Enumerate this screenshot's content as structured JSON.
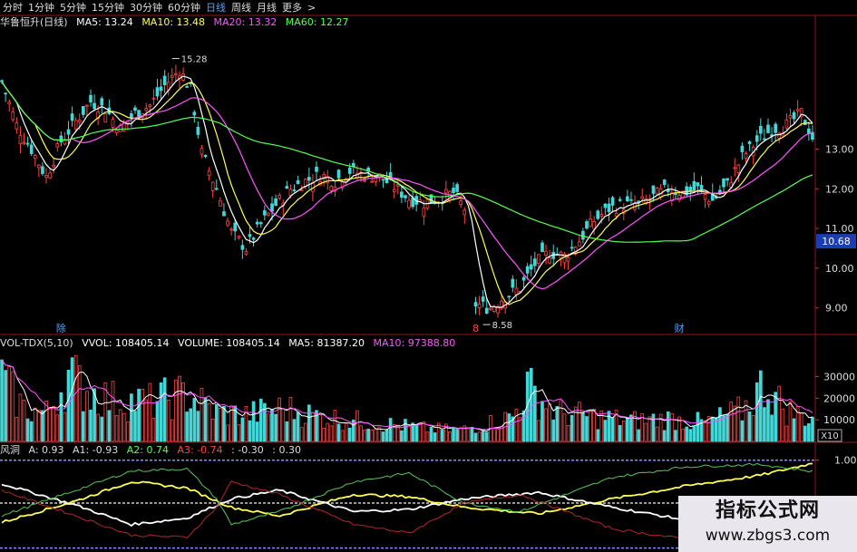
{
  "tabs": [
    {
      "label": "分时",
      "active": false
    },
    {
      "label": "1分钟",
      "active": false
    },
    {
      "label": "5分钟",
      "active": false
    },
    {
      "label": "15分钟",
      "active": false
    },
    {
      "label": "30分钟",
      "active": false
    },
    {
      "label": "60分钟",
      "active": false
    },
    {
      "label": "日线",
      "active": true
    },
    {
      "label": "周线",
      "active": false
    },
    {
      "label": "月线",
      "active": false
    },
    {
      "label": "更多",
      "active": false
    },
    {
      "label": ">",
      "active": false
    }
  ],
  "price_info": {
    "stock": "华鲁恒升(日线)",
    "ma5": "MA5: 13.24",
    "ma10": "MA10: 13.48",
    "ma20": "MA20: 13.32",
    "ma60": "MA60: 12.27"
  },
  "vol_info": {
    "name": "VOL-TDX(5,10)",
    "vvol": "VVOL: 108405.14",
    "volume": "VOLUME: 108405.14",
    "ma5": "MA5: 81387.20",
    "ma10": "MA10: 97388.80"
  },
  "ind_info": {
    "name": "风洞",
    "a": "A: 0.93",
    "a1": "A1: -0.93",
    "a2": "A2: 0.74",
    "a3": "A3: -0.74",
    "v1": ": -0.30",
    "v2": ": 0.30"
  },
  "colors": {
    "up": "#ff4545",
    "down": "#45d6d6",
    "ma5": "#ffffff",
    "ma10": "#ffff55",
    "ma20": "#ff55ff",
    "ma60": "#55ff55",
    "axis": "#8a1a1a",
    "grid": "#5a1010"
  },
  "watermark": {
    "title": "指标公式网",
    "url": "www.zbgs3.com"
  },
  "chart_data": [
    {
      "type": "candlestick",
      "y_ticks": [
        9.0,
        10.0,
        11.0,
        12.0,
        13.0
      ],
      "ylim": [
        8.4,
        16.0
      ],
      "current_price": "10.68",
      "annotations": [
        {
          "text": "15.28",
          "index": 46,
          "value": 15.28
        },
        {
          "text": "8.58",
          "index": 130,
          "value": 8.58
        }
      ],
      "markers": [
        {
          "text": "除",
          "index": 16,
          "color": "#4fa3ff"
        },
        {
          "text": "8",
          "index": 128,
          "color": "#ff4545"
        },
        {
          "text": "财",
          "index": 183,
          "color": "#4fa3ff"
        }
      ],
      "close_anchors": [
        [
          0,
          14.7
        ],
        [
          4,
          13.6
        ],
        [
          8,
          13.0
        ],
        [
          12,
          12.3
        ],
        [
          16,
          13.2
        ],
        [
          20,
          13.7
        ],
        [
          24,
          14.2
        ],
        [
          28,
          14.0
        ],
        [
          32,
          13.5
        ],
        [
          36,
          13.9
        ],
        [
          40,
          14.1
        ],
        [
          44,
          14.6
        ],
        [
          48,
          15.0
        ],
        [
          51,
          14.5
        ],
        [
          54,
          12.9
        ],
        [
          58,
          12.0
        ],
        [
          62,
          10.9
        ],
        [
          66,
          10.5
        ],
        [
          70,
          11.1
        ],
        [
          74,
          11.6
        ],
        [
          78,
          12.0
        ],
        [
          82,
          12.2
        ],
        [
          86,
          12.35
        ],
        [
          90,
          12.2
        ],
        [
          94,
          12.45
        ],
        [
          98,
          12.35
        ],
        [
          102,
          12.3
        ],
        [
          106,
          12.05
        ],
        [
          110,
          11.75
        ],
        [
          114,
          11.65
        ],
        [
          118,
          11.75
        ],
        [
          122,
          11.9
        ],
        [
          125,
          11.5
        ],
        [
          128,
          9.1
        ],
        [
          132,
          9.0
        ],
        [
          136,
          9.3
        ],
        [
          140,
          9.5
        ],
        [
          144,
          10.1
        ],
        [
          148,
          10.4
        ],
        [
          152,
          10.3
        ],
        [
          156,
          10.7
        ],
        [
          160,
          11.2
        ],
        [
          164,
          11.5
        ],
        [
          168,
          11.6
        ],
        [
          172,
          11.6
        ],
        [
          176,
          11.8
        ],
        [
          180,
          12.0
        ],
        [
          184,
          11.9
        ],
        [
          188,
          12.0
        ],
        [
          192,
          11.7
        ],
        [
          196,
          12.1
        ],
        [
          200,
          12.8
        ],
        [
          204,
          13.2
        ],
        [
          208,
          13.5
        ],
        [
          212,
          13.6
        ],
        [
          216,
          13.9
        ],
        [
          219,
          13.3
        ]
      ]
    },
    {
      "type": "bar",
      "name": "VOL-TDX(5,10)",
      "y_ticks": [
        10000,
        20000,
        30000
      ],
      "unit_label": "X10",
      "ylim": [
        0,
        42000
      ],
      "volume_anchors": [
        [
          0,
          30000
        ],
        [
          6,
          16000
        ],
        [
          12,
          14000
        ],
        [
          18,
          32000
        ],
        [
          24,
          24000
        ],
        [
          30,
          20000
        ],
        [
          40,
          19000
        ],
        [
          50,
          23000
        ],
        [
          58,
          14000
        ],
        [
          66,
          13000
        ],
        [
          76,
          16000
        ],
        [
          86,
          12000
        ],
        [
          96,
          10000
        ],
        [
          106,
          8000
        ],
        [
          116,
          6000
        ],
        [
          124,
          5500
        ],
        [
          132,
          9000
        ],
        [
          138,
          12000
        ],
        [
          142,
          26000
        ],
        [
          150,
          14000
        ],
        [
          160,
          12000
        ],
        [
          170,
          10000
        ],
        [
          180,
          11000
        ],
        [
          190,
          9000
        ],
        [
          200,
          15000
        ],
        [
          206,
          28000
        ],
        [
          212,
          15000
        ],
        [
          219,
          11000
        ]
      ]
    },
    {
      "type": "line",
      "name": "风洞",
      "y_ticks": [
        1.0,
        0.0
      ],
      "ylim": [
        -1.1,
        1.1
      ],
      "series": [
        {
          "name": "A",
          "color": "#ffff55",
          "points": [
            [
              0,
              -0.45
            ],
            [
              20,
              0.05
            ],
            [
              35,
              0.5
            ],
            [
              50,
              0.35
            ],
            [
              62,
              -0.1
            ],
            [
              75,
              -0.3
            ],
            [
              95,
              0.2
            ],
            [
              110,
              0.15
            ],
            [
              125,
              -0.1
            ],
            [
              145,
              -0.25
            ],
            [
              165,
              0.1
            ],
            [
              185,
              0.4
            ],
            [
              205,
              0.65
            ],
            [
              219,
              0.93
            ]
          ]
        },
        {
          "name": "A1",
          "color": "#ffffff",
          "points": [
            [
              0,
              0.45
            ],
            [
              20,
              -0.05
            ],
            [
              35,
              -0.5
            ],
            [
              50,
              -0.35
            ],
            [
              62,
              0.1
            ],
            [
              75,
              0.3
            ],
            [
              95,
              -0.2
            ],
            [
              110,
              -0.15
            ],
            [
              125,
              0.1
            ],
            [
              145,
              0.25
            ],
            [
              165,
              -0.1
            ],
            [
              185,
              -0.4
            ],
            [
              205,
              -0.65
            ],
            [
              219,
              -0.93
            ]
          ]
        },
        {
          "name": "A2",
          "color": "#55c855",
          "points": [
            [
              0,
              -0.3
            ],
            [
              20,
              0.3
            ],
            [
              35,
              0.75
            ],
            [
              50,
              0.8
            ],
            [
              58,
              0.1
            ],
            [
              62,
              -0.5
            ],
            [
              75,
              -0.2
            ],
            [
              95,
              0.5
            ],
            [
              110,
              0.7
            ],
            [
              125,
              0.0
            ],
            [
              140,
              -0.2
            ],
            [
              165,
              0.6
            ],
            [
              185,
              0.85
            ],
            [
              205,
              0.9
            ],
            [
              219,
              0.74
            ]
          ]
        },
        {
          "name": "A3",
          "color": "#b42828",
          "points": [
            [
              0,
              0.3
            ],
            [
              20,
              -0.3
            ],
            [
              35,
              -0.75
            ],
            [
              50,
              -0.8
            ],
            [
              58,
              -0.1
            ],
            [
              62,
              0.5
            ],
            [
              75,
              0.2
            ],
            [
              95,
              -0.5
            ],
            [
              110,
              -0.7
            ],
            [
              125,
              0.0
            ],
            [
              140,
              0.2
            ],
            [
              165,
              -0.6
            ],
            [
              185,
              -0.85
            ],
            [
              205,
              -0.9
            ],
            [
              219,
              -0.74
            ]
          ]
        }
      ]
    }
  ]
}
